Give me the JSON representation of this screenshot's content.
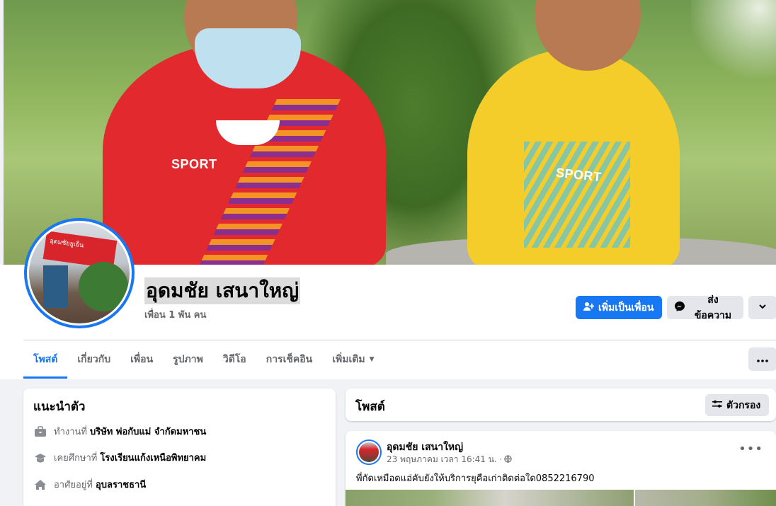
{
  "profile": {
    "name": "อุดมชัย เสนาใหญ่",
    "friends": "เพื่อน 1 พัน คน",
    "avatar_banner_text": "อุดมชัยยูเย็น"
  },
  "cover": {
    "shirt_text_left": "SPORT",
    "shirt_text_right": "SPORT"
  },
  "actions": {
    "add_friend": "เพิ่มเป็นเพื่อน",
    "message": "ส่งข้อความ"
  },
  "tabs": [
    {
      "label": "โพสต์",
      "active": true
    },
    {
      "label": "เกี่ยวกับ"
    },
    {
      "label": "เพื่อน"
    },
    {
      "label": "รูปภาพ"
    },
    {
      "label": "วิดีโอ"
    },
    {
      "label": "การเช็คอิน"
    },
    {
      "label": "เพิ่มเติม"
    }
  ],
  "intro": {
    "title": "แนะนำตัว",
    "work": {
      "prefix": "ทำงานที่",
      "value": "บริษัท พ่อกับแม่ จำกัดมหาชน"
    },
    "study": {
      "prefix": "เคยศึกษาที่",
      "value": "โรงเรียนแก้งเหนือพิทยาคม"
    },
    "lives": {
      "prefix": "อาศัยอยู่ที่",
      "value": "อุบลราชธานี"
    }
  },
  "posts_header": {
    "title": "โพสต์",
    "filter_label": "ตัวกรอง"
  },
  "post": {
    "author": "อุดมชัย เสนาใหญ่",
    "time": "23 พฤษภาคม เวลา 16:41 น. ·",
    "text": "พี่กัดเหมือดแอ่คับยังให้บริการยุคือเก่าติดต่อใด0852216790"
  },
  "colors": {
    "accent": "#1877f2",
    "background": "#f0f2f5",
    "secondary_button": "#e4e6eb"
  },
  "icons": [
    "add-friend-icon",
    "messenger-icon",
    "chevron-down-icon",
    "more-icon",
    "briefcase-icon",
    "graduation-cap-icon",
    "home-icon",
    "filter-icon",
    "globe-icon"
  ]
}
